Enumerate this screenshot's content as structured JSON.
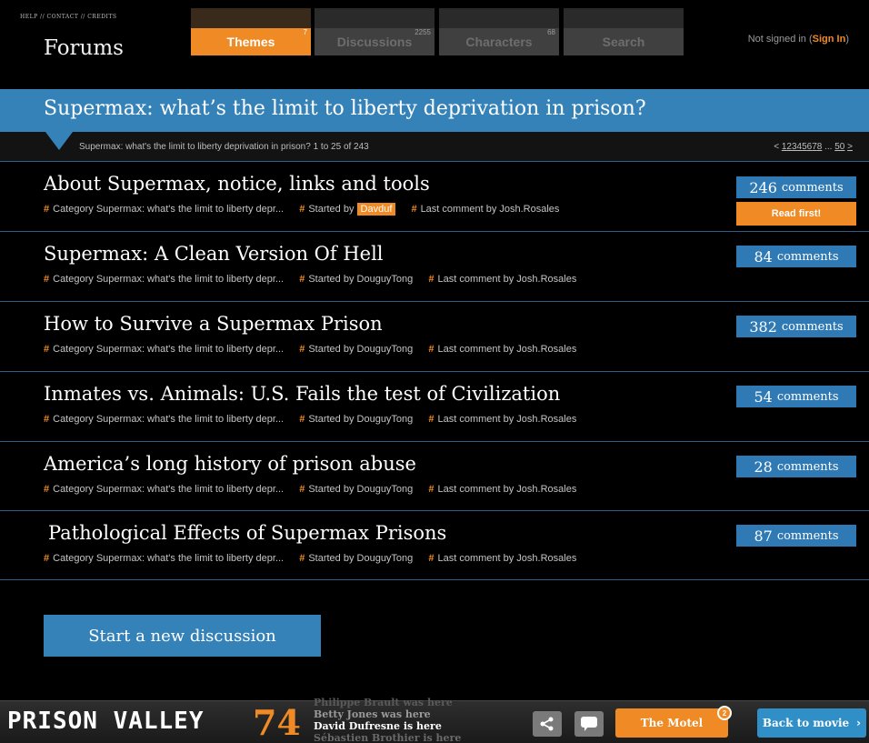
{
  "header": {
    "top_links": "HELP // CONTACT // CREDITS",
    "title": "Forums",
    "tabs": [
      {
        "label": "Themes",
        "count": "7"
      },
      {
        "label": "Discussions",
        "count": "2255"
      },
      {
        "label": "Characters",
        "count": "68"
      },
      {
        "label": "Search",
        "count": ""
      }
    ],
    "signin_text": "Not signed in (",
    "signin_link": "Sign In",
    "signin_close": ")"
  },
  "thread": {
    "title": "Supermax: what’s the limit to liberty deprivation in prison?",
    "breadcrumb": "Supermax: what's the limit to liberty deprivation in prison? 1 to 25 of 243",
    "pager": {
      "prev": "<",
      "pages": [
        "1",
        "2",
        "3",
        "4",
        "5",
        "6",
        "7",
        "8"
      ],
      "ellipsis": "...",
      "last": "50",
      "next": ">"
    }
  },
  "discussions": [
    {
      "title": "About Supermax, notice, links and tools",
      "category": "Category Supermax: what's the limit to liberty depr...",
      "started_by_label": "Started by",
      "author": "Davduf",
      "last_comment": "Last comment by Josh.Rosales",
      "comments_count": "246",
      "comments_label": "comments",
      "read_first": "Read first!"
    },
    {
      "title": "Supermax: A Clean Version Of Hell",
      "category": "Category Supermax: what's the limit to liberty depr...",
      "started_by_label": "Started by",
      "author": "DouguyTong",
      "last_comment": "Last comment by Josh.Rosales",
      "comments_count": "84",
      "comments_label": "comments"
    },
    {
      "title": "How to Survive a Supermax Prison",
      "category": "Category Supermax: what's the limit to liberty depr...",
      "started_by_label": "Started by",
      "author": "DouguyTong",
      "last_comment": "Last comment by Josh.Rosales",
      "comments_count": "382",
      "comments_label": "comments"
    },
    {
      "title": "Inmates vs. Animals:  U.S. Fails the test of Civilization",
      "category": "Category Supermax: what's the limit to liberty depr...",
      "started_by_label": "Started by",
      "author": "DouguyTong",
      "last_comment": "Last comment by Josh.Rosales",
      "comments_count": "54",
      "comments_label": "comments"
    },
    {
      "title": "America’s long history of prison abuse",
      "category": "Category Supermax: what's the limit to liberty depr...",
      "started_by_label": "Started by",
      "author": "DouguyTong",
      "last_comment": "Last comment by Josh.Rosales",
      "comments_count": "28",
      "comments_label": "comments"
    },
    {
      "title": "Pathological Effects of Supermax Prisons",
      "category": "Category Supermax: what's the limit to liberty depr...",
      "started_by_label": "Started by",
      "author": "DouguyTong",
      "last_comment": "Last comment by Josh.Rosales",
      "comments_count": "87",
      "comments_label": "comments"
    }
  ],
  "new_discussion_label": "Start a new discussion",
  "footer": {
    "logo_text": "PRISON VALLEY",
    "logo_number": "74",
    "presence": [
      "Philippe Brault was here",
      "Betty Jones was here",
      "David Dufresne is here",
      "Sébastien Brothier is here"
    ],
    "motel_label": "The Motel",
    "motel_badge": "2",
    "back_label": "Back to movie",
    "back_icon": "chevron-right-icon",
    "share_icon": "share-icon",
    "chat_icon": "speech-bubble-icon"
  },
  "colors": {
    "accent_orange": "#f08a24",
    "accent_blue": "#3582b8",
    "background": "#000000"
  }
}
